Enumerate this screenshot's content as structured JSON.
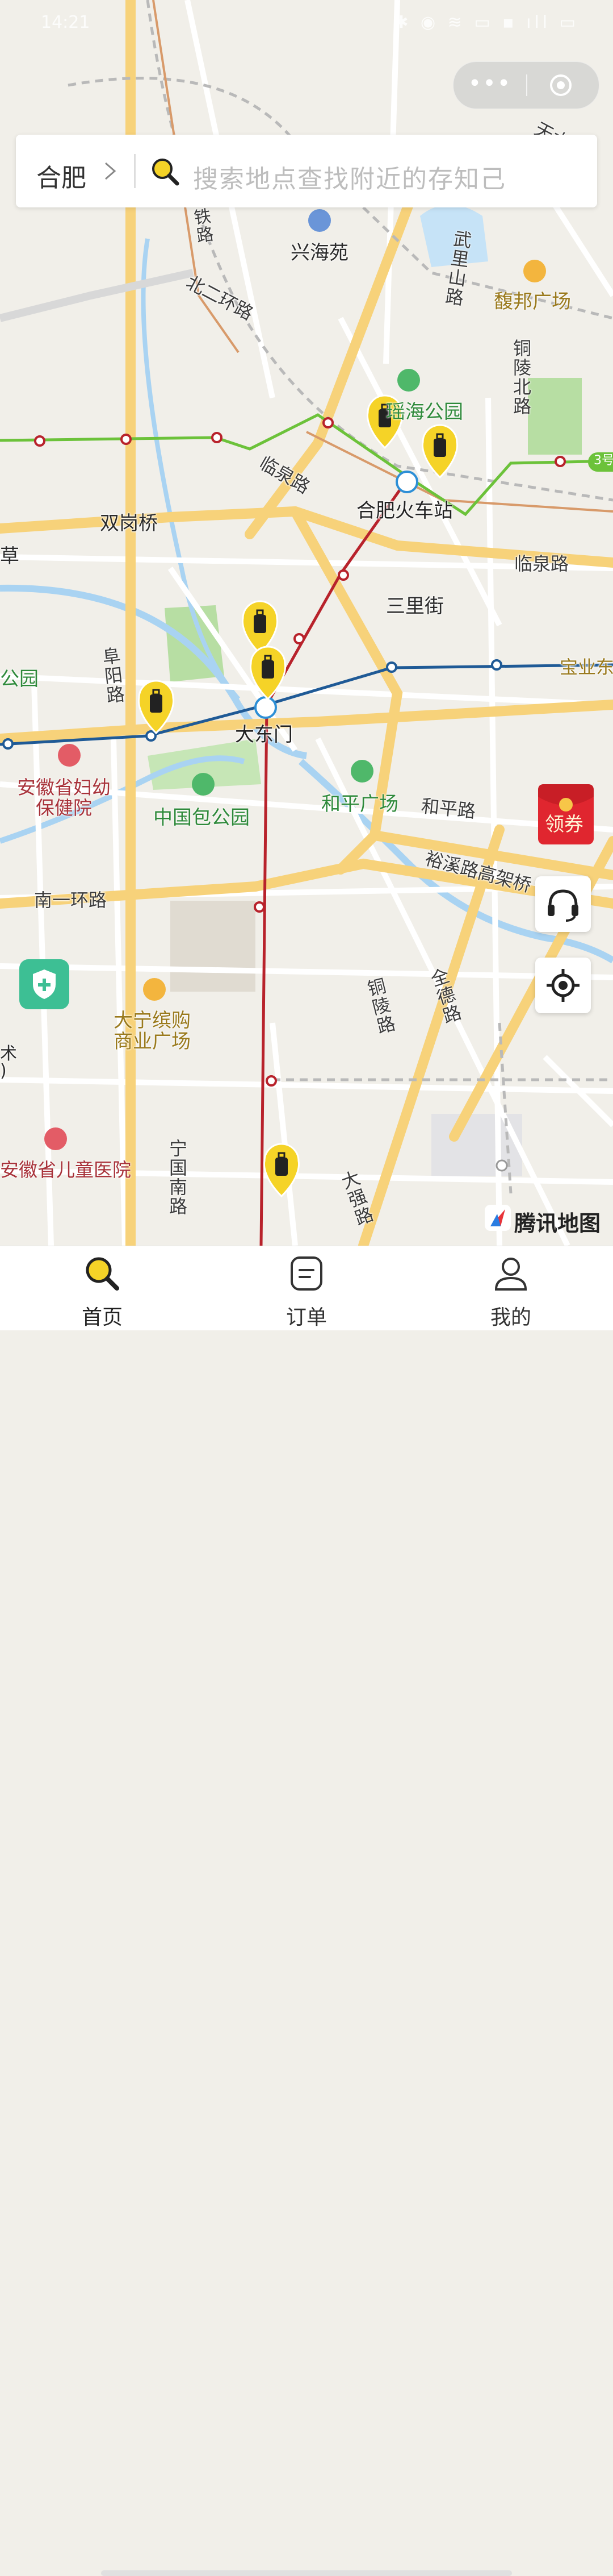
{
  "status_bar": {
    "time": "14:21",
    "icons": "✱ ◉ ≋ ▭ ▪ ıll ▭"
  },
  "capsule": {
    "more": "•••"
  },
  "search": {
    "city": "合肥",
    "placeholder": "搜索地点查找附近的存知己"
  },
  "map": {
    "places": {
      "xinghaiyuan": "兴海苑",
      "fubang": "馥邦广场",
      "park_north": "瑶海公园",
      "shuanggangqiao": "双岗桥",
      "hefei_station": "合肥火车站",
      "sanlijie": "三里街",
      "dadongmen": "大东门",
      "zhongguobao": "中国包公园",
      "heping_square": "和平广场",
      "maternal_hospital": "安徽省妇幼\n保健院",
      "daning": "大宁缤购\n商业广场",
      "children_hospital": "安徽省儿童医院",
      "park_left": "公园",
      "art_edge": "术\n)",
      "edge_left": "草"
    },
    "roads": {
      "beierhuan": "北二环路",
      "wulishan": "武里山路",
      "tonglingbei": "铜陵北路",
      "linquan1": "临泉路",
      "linquan2": "临泉路",
      "fuyang": "阜阳路",
      "baoye": "宝业东",
      "heping": "和平路",
      "yuxi": "裕溪路高架桥",
      "nanyihuan": "南一环路",
      "tongling": "铜陵路",
      "quande": "全德路",
      "ningguonan": "宁国南路",
      "daqiang": "大强路",
      "railway": "铁路",
      "tianshui": "天水"
    },
    "line_badge": "3号",
    "coupon_label": "领券",
    "provider": "腾讯地图",
    "colors": {
      "line_green": "#6cc23a",
      "line_red": "#b8222b",
      "line_blue": "#1f5a96",
      "arterial": "#f7d27a",
      "water": "#a9d3f2",
      "pin": "#f5d327",
      "park": "#b7dea3"
    }
  },
  "tabs": [
    {
      "label": "首页",
      "icon": "search-icon",
      "active": true
    },
    {
      "label": "订单",
      "icon": "order-icon",
      "active": false
    },
    {
      "label": "我的",
      "icon": "user-icon",
      "active": false
    }
  ]
}
